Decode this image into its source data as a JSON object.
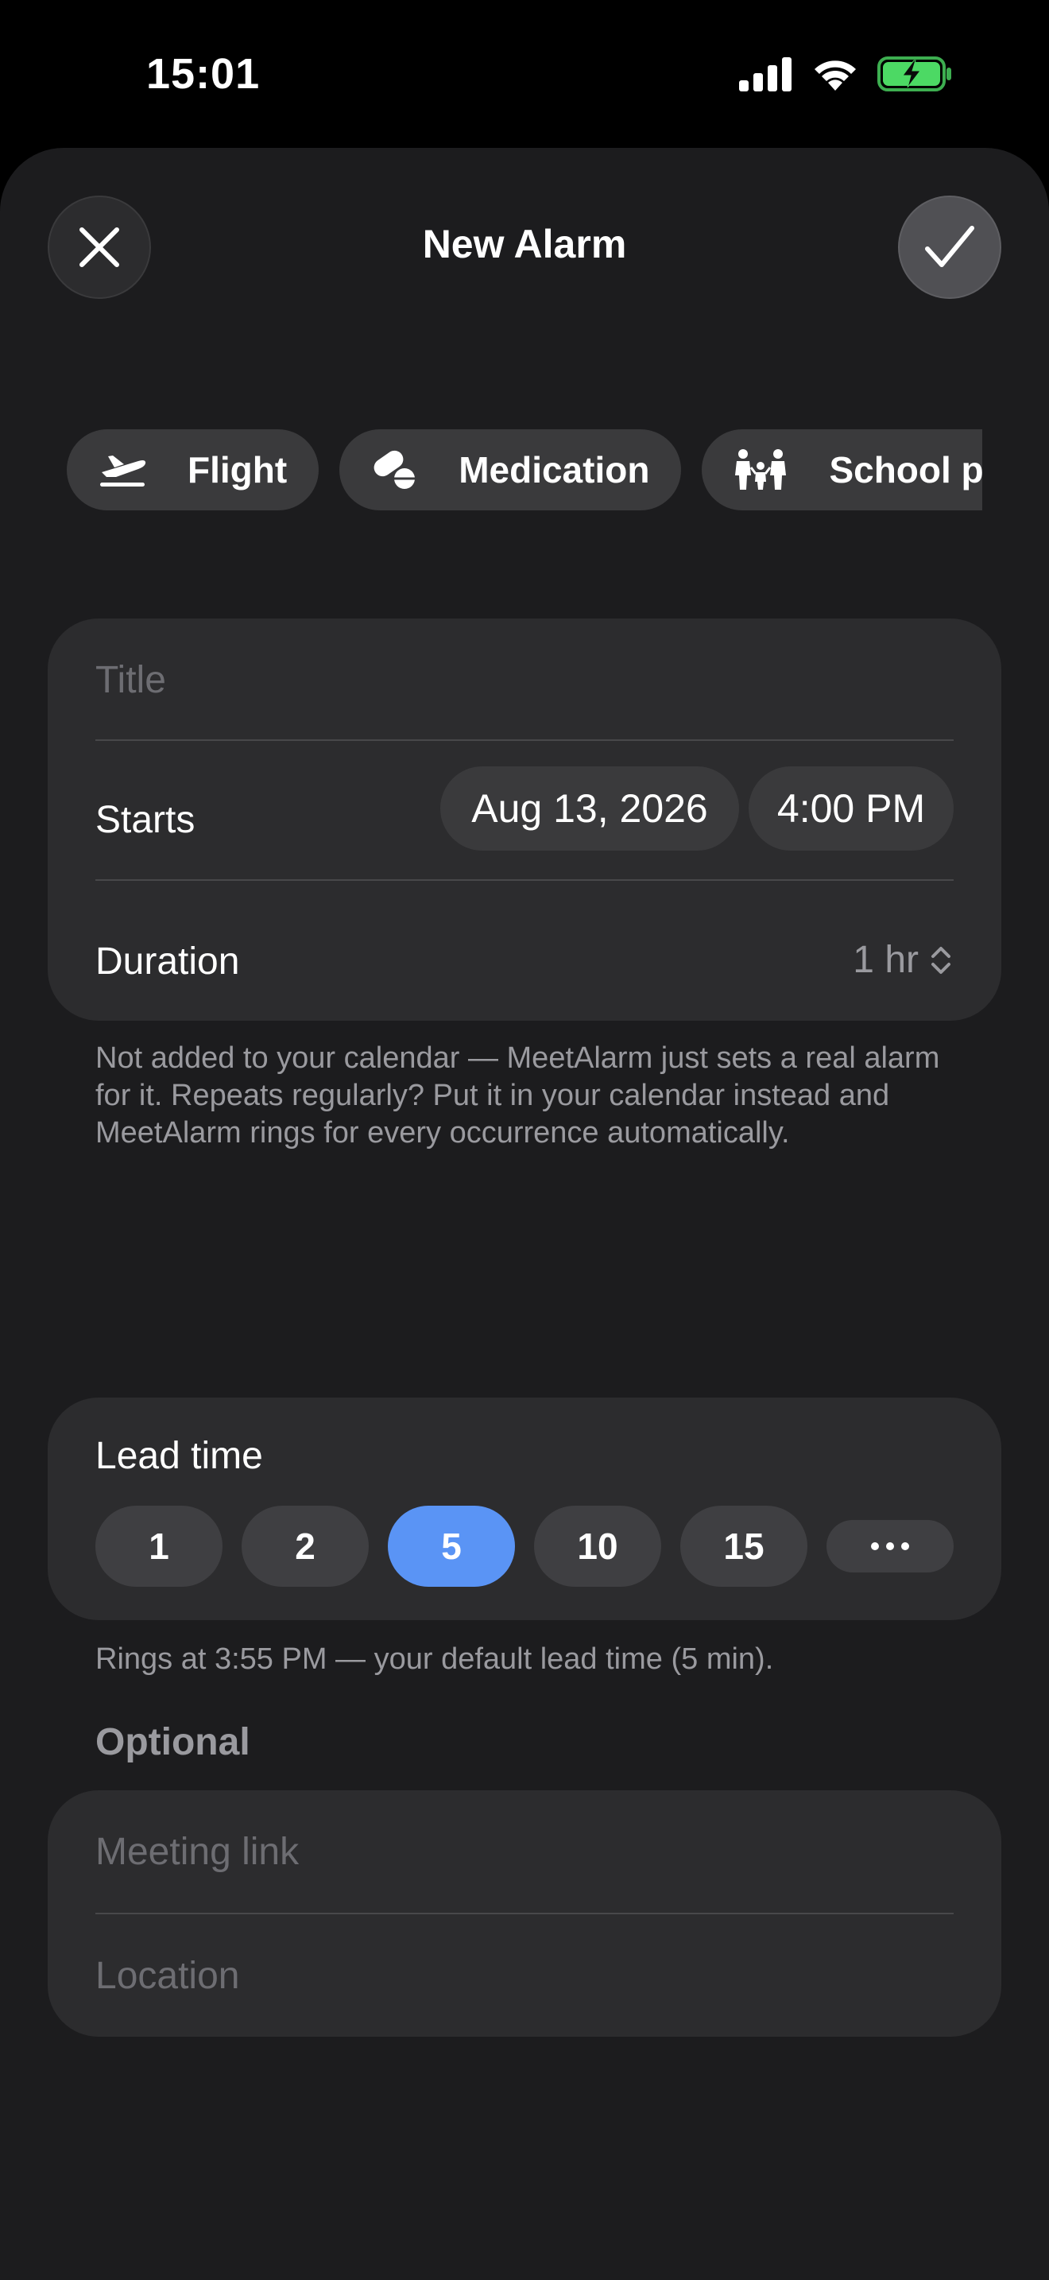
{
  "status_bar": {
    "time": "15:01",
    "icons": [
      "signal-icon",
      "wifi-icon",
      "battery-charging-icon"
    ],
    "battery_color": "#4cd964"
  },
  "header": {
    "title": "New Alarm",
    "close_icon": "close-icon",
    "confirm_icon": "checkmark-icon"
  },
  "presets": [
    {
      "label": "Flight",
      "icon": "airplane-takeoff-icon"
    },
    {
      "label": "Medication",
      "icon": "pills-icon"
    },
    {
      "label": "School pic",
      "icon": "family-icon"
    }
  ],
  "form": {
    "title_placeholder": "Title",
    "starts_label": "Starts",
    "start_date": "Aug 13, 2026",
    "start_time": "4:00 PM",
    "duration_label": "Duration",
    "duration_value": "1 hr",
    "help_text": "Not added to your calendar — MeetAlarm just sets a real alarm for it. Repeats regularly? Put it in your calendar instead and MeetAlarm rings for every occurrence automatically."
  },
  "lead_time": {
    "label": "Lead time",
    "options": [
      "1",
      "2",
      "5",
      "10",
      "15"
    ],
    "selected": "5",
    "more_icon": "ellipsis-icon",
    "accent": "#5a94f5",
    "rings_text": "Rings at 3:55 PM — your default lead time (5 min)."
  },
  "optional": {
    "heading": "Optional",
    "meeting_link_placeholder": "Meeting link",
    "location_placeholder": "Location"
  }
}
